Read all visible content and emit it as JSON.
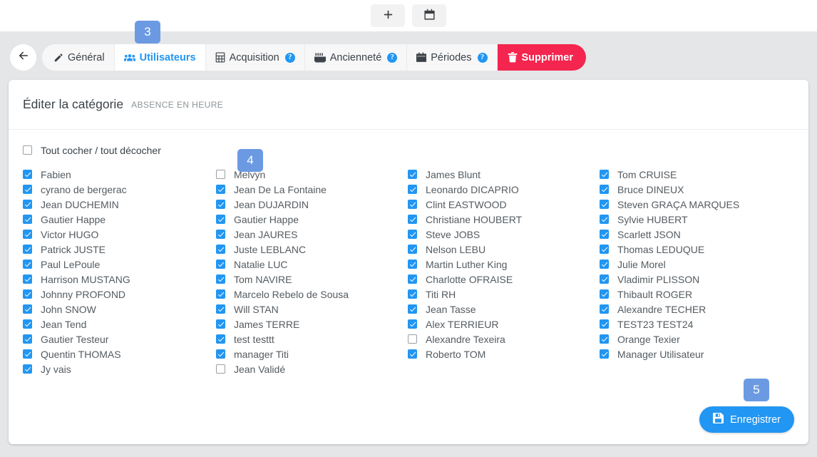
{
  "toolbar": {
    "add_button_label": "+",
    "add_button_icon": "plus-icon",
    "calendar_button_icon": "calendar-icon"
  },
  "tabbar": {
    "back_icon": "arrow-left-icon",
    "tabs": [
      {
        "label": "Général",
        "icon": "pencil-icon",
        "active": false,
        "help": false
      },
      {
        "label": "Utilisateurs",
        "icon": "users-icon",
        "active": true,
        "help": false
      },
      {
        "label": "Acquisition",
        "icon": "calculator-icon",
        "active": false,
        "help": true
      },
      {
        "label": "Ancienneté",
        "icon": "factory-icon",
        "active": false,
        "help": true
      },
      {
        "label": "Périodes",
        "icon": "calendar-icon",
        "active": false,
        "help": true
      }
    ],
    "delete_tab": {
      "label": "Supprimer",
      "icon": "trash-icon"
    },
    "help_glyph": "?"
  },
  "card": {
    "title": "Éditer la catégorie",
    "subtitle": "ABSENCE EN HEURE",
    "select_all_label": "Tout cocher / tout décocher",
    "select_all_checked": false,
    "save_label": "Enregistrer",
    "save_icon": "save-icon"
  },
  "columns": [
    {
      "items": [
        {
          "label": "Fabien",
          "checked": true
        },
        {
          "label": "cyrano de bergerac",
          "checked": true
        },
        {
          "label": "Jean DUCHEMIN",
          "checked": true
        },
        {
          "label": "Gautier Happe",
          "checked": true
        },
        {
          "label": "Victor HUGO",
          "checked": true
        },
        {
          "label": "Patrick JUSTE",
          "checked": true
        },
        {
          "label": "Paul LePoule",
          "checked": true
        },
        {
          "label": "Harrison MUSTANG",
          "checked": true
        },
        {
          "label": "Johnny PROFOND",
          "checked": true
        },
        {
          "label": "John SNOW",
          "checked": true
        },
        {
          "label": "Jean Tend",
          "checked": true
        },
        {
          "label": "Gautier Testeur",
          "checked": true
        },
        {
          "label": "Quentin THOMAS",
          "checked": true
        },
        {
          "label": "Jy vais",
          "checked": true
        }
      ]
    },
    {
      "items": [
        {
          "label": "Melvyn",
          "checked": false
        },
        {
          "label": "Jean De La Fontaine",
          "checked": true
        },
        {
          "label": "Jean DUJARDIN",
          "checked": true
        },
        {
          "label": "Gautier Happe",
          "checked": true
        },
        {
          "label": "Jean JAURES",
          "checked": true
        },
        {
          "label": "Juste LEBLANC",
          "checked": true
        },
        {
          "label": "Natalie LUC",
          "checked": true
        },
        {
          "label": "Tom NAVIRE",
          "checked": true
        },
        {
          "label": "Marcelo Rebelo de Sousa",
          "checked": true
        },
        {
          "label": "Will STAN",
          "checked": true
        },
        {
          "label": "James TERRE",
          "checked": true
        },
        {
          "label": "test testtt",
          "checked": true
        },
        {
          "label": "manager Titi",
          "checked": true
        },
        {
          "label": "Jean Validé",
          "checked": false
        }
      ]
    },
    {
      "items": [
        {
          "label": "James Blunt",
          "checked": true
        },
        {
          "label": "Leonardo DICAPRIO",
          "checked": true
        },
        {
          "label": "Clint EASTWOOD",
          "checked": true
        },
        {
          "label": "Christiane HOUBERT",
          "checked": true
        },
        {
          "label": "Steve JOBS",
          "checked": true
        },
        {
          "label": "Nelson LEBU",
          "checked": true
        },
        {
          "label": "Martin Luther King",
          "checked": true
        },
        {
          "label": "Charlotte OFRAISE",
          "checked": true
        },
        {
          "label": "Titi RH",
          "checked": true
        },
        {
          "label": "Jean Tasse",
          "checked": true
        },
        {
          "label": "Alex TERRIEUR",
          "checked": true
        },
        {
          "label": "Alexandre Texeira",
          "checked": false
        },
        {
          "label": "Roberto TOM",
          "checked": true
        }
      ]
    },
    {
      "items": [
        {
          "label": "Tom CRUISE",
          "checked": true
        },
        {
          "label": "Bruce DINEUX",
          "checked": true
        },
        {
          "label": "Steven GRAÇA MARQUES",
          "checked": true
        },
        {
          "label": "Sylvie HUBERT",
          "checked": true
        },
        {
          "label": "Scarlett JSON",
          "checked": true
        },
        {
          "label": "Thomas LEDUQUE",
          "checked": true
        },
        {
          "label": "Julie Morel",
          "checked": true
        },
        {
          "label": "Vladimir PLISSON",
          "checked": true
        },
        {
          "label": "Thibault ROGER",
          "checked": true
        },
        {
          "label": "Alexandre TECHER",
          "checked": true
        },
        {
          "label": "TEST23 TEST24",
          "checked": true
        },
        {
          "label": "Orange Texier",
          "checked": true
        },
        {
          "label": "Manager Utilisateur",
          "checked": true
        }
      ]
    }
  ],
  "step_badges": [
    {
      "number": "3"
    },
    {
      "number": "4"
    },
    {
      "number": "5"
    }
  ],
  "colors": {
    "accent": "#2196f3",
    "danger": "#f4254e",
    "badge": "#6b9ae2",
    "page_bg": "#e4e6e7",
    "card_bg": "#ffffff",
    "text": "#545b61"
  }
}
